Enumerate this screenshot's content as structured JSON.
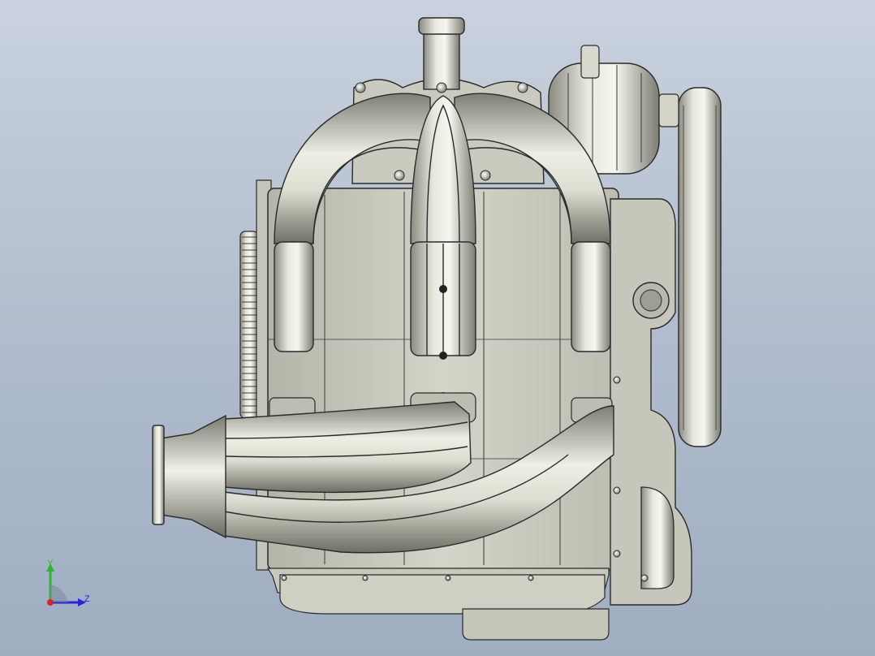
{
  "viewport": {
    "background_top": "#c9d2de",
    "background_bottom": "#9fadc1",
    "model_color": "#c8c8bc",
    "edge_color": "#2a2a2a"
  },
  "triad": {
    "y_label": "Y",
    "z_label": "Z",
    "y_color": "#2db52d",
    "z_color": "#2424d8",
    "x_color": "#d82424"
  }
}
